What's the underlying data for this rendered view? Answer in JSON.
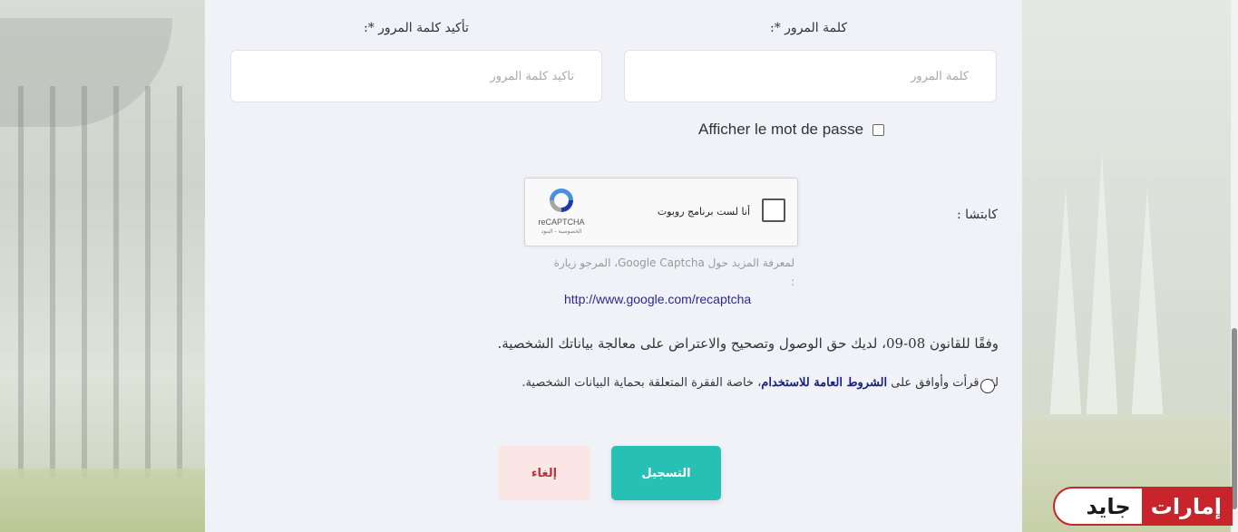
{
  "form": {
    "password_label": "كلمة المرور *:",
    "password_placeholder": "كلمة المرور",
    "confirm_label": "تأكيد كلمة المرور *:",
    "confirm_placeholder": "تأكيد كلمة المرور",
    "show_password_label": "Afficher le mot de passe"
  },
  "captcha": {
    "label": "كابتشا :",
    "checkbox_text": "أنا لست برنامج روبوت",
    "brand": "reCAPTCHA",
    "privacy": "الخصوصية - البنود",
    "info_text": "لمعرفة المزيد حول Google Captcha، المرجو زيارة :",
    "link": "http://www.google.com/recaptcha"
  },
  "legal": {
    "law_text": "وفقًا للقانون 08-09، لديك حق الوصول وتصحيح والاعتراض على معالجة بياناتك الشخصية.",
    "terms_prefix": "لقد قرأت وأوافق على",
    "terms_link": "الشروط العامة للاستخدام",
    "terms_suffix": "، خاصة الفقرة المتعلقة بحماية البيانات الشخصية."
  },
  "buttons": {
    "register": "التسجيل",
    "cancel": "إلغاء"
  },
  "watermark": {
    "part1": "إمارات",
    "part2": "جايد"
  },
  "colors": {
    "register_bg": "#26c1b4",
    "cancel_bg": "#fbe6e6",
    "cancel_text": "#b03a3a",
    "link": "#2a2a8a",
    "watermark_red": "#c8242c"
  }
}
